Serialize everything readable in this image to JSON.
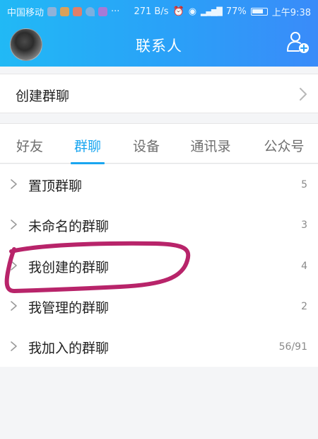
{
  "status_bar": {
    "carrier": "中国移动",
    "network_speed": "271 B/s",
    "battery": "77%",
    "time": "上午9:38"
  },
  "header": {
    "title": "联系人"
  },
  "create_group": {
    "label": "创建群聊"
  },
  "tabs": [
    {
      "label": "好友",
      "active": false
    },
    {
      "label": "群聊",
      "active": true
    },
    {
      "label": "设备",
      "active": false
    },
    {
      "label": "通讯录",
      "active": false
    },
    {
      "label": "公众号",
      "active": false
    }
  ],
  "groups": [
    {
      "name": "置顶群聊",
      "count": "5"
    },
    {
      "name": "未命名的群聊",
      "count": "3"
    },
    {
      "name": "我创建的群聊",
      "count": "4"
    },
    {
      "name": "我管理的群聊",
      "count": "2"
    },
    {
      "name": "我加入的群聊",
      "count": "56/91"
    }
  ],
  "colors": {
    "header_start": "#21b9f5",
    "header_end": "#3a8bf9",
    "tab_active": "#1aa6f0",
    "annotation_stroke": "#b8246a"
  }
}
